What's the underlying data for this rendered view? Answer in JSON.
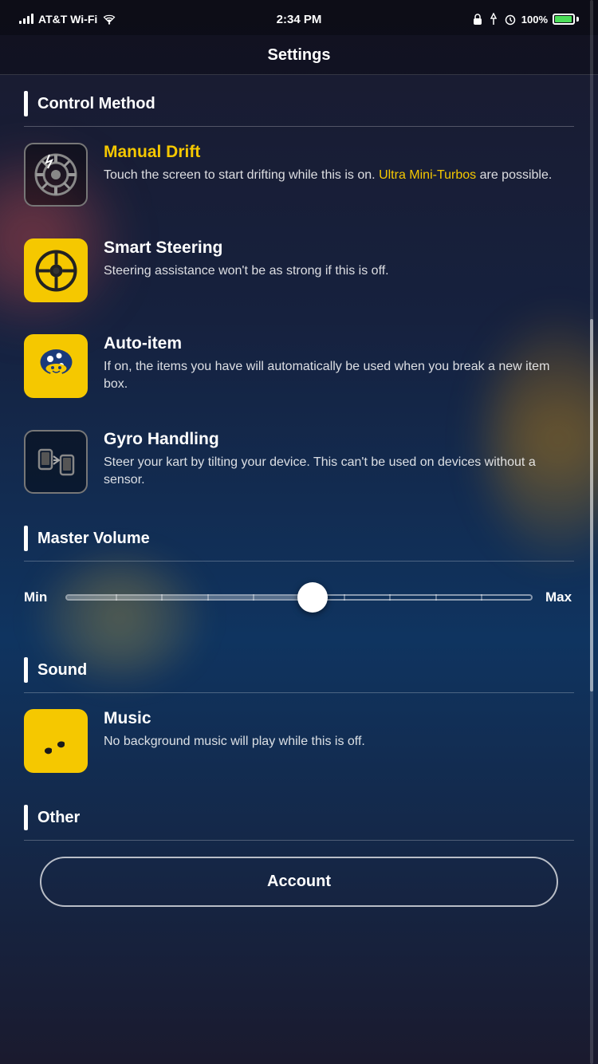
{
  "statusBar": {
    "carrier": "AT&T Wi-Fi",
    "time": "2:34 PM",
    "battery": "100%"
  },
  "header": {
    "title": "Settings"
  },
  "sections": {
    "controlMethod": {
      "label": "Control Method",
      "items": [
        {
          "id": "manual-drift",
          "title": "Manual Drift",
          "titleColor": "yellow",
          "iconStyle": "bordered",
          "description": "Touch the screen to start drifting while this is on. ",
          "highlight": "Ultra Mini-Turbos",
          "descriptionEnd": " are possible."
        },
        {
          "id": "smart-steering",
          "title": "Smart Steering",
          "titleColor": "white",
          "iconStyle": "yellow",
          "description": "Steering assistance won't be as strong if this is off."
        },
        {
          "id": "auto-item",
          "title": "Auto-item",
          "titleColor": "white",
          "iconStyle": "yellow",
          "description": "If on, the items you have will automatically be used when you break a new item box."
        },
        {
          "id": "gyro-handling",
          "title": "Gyro Handling",
          "titleColor": "white",
          "iconStyle": "bordered",
          "description": "Steer your kart by tilting your device. This can't be used on devices without a sensor."
        }
      ]
    },
    "masterVolume": {
      "label": "Master Volume",
      "minLabel": "Min",
      "maxLabel": "Max",
      "sliderValue": 55
    },
    "sound": {
      "label": "Sound",
      "items": [
        {
          "id": "music",
          "title": "Music",
          "titleColor": "white",
          "iconStyle": "yellow",
          "description": "No background music will play while this is off."
        }
      ]
    },
    "other": {
      "label": "Other",
      "accountButton": "Account"
    }
  }
}
